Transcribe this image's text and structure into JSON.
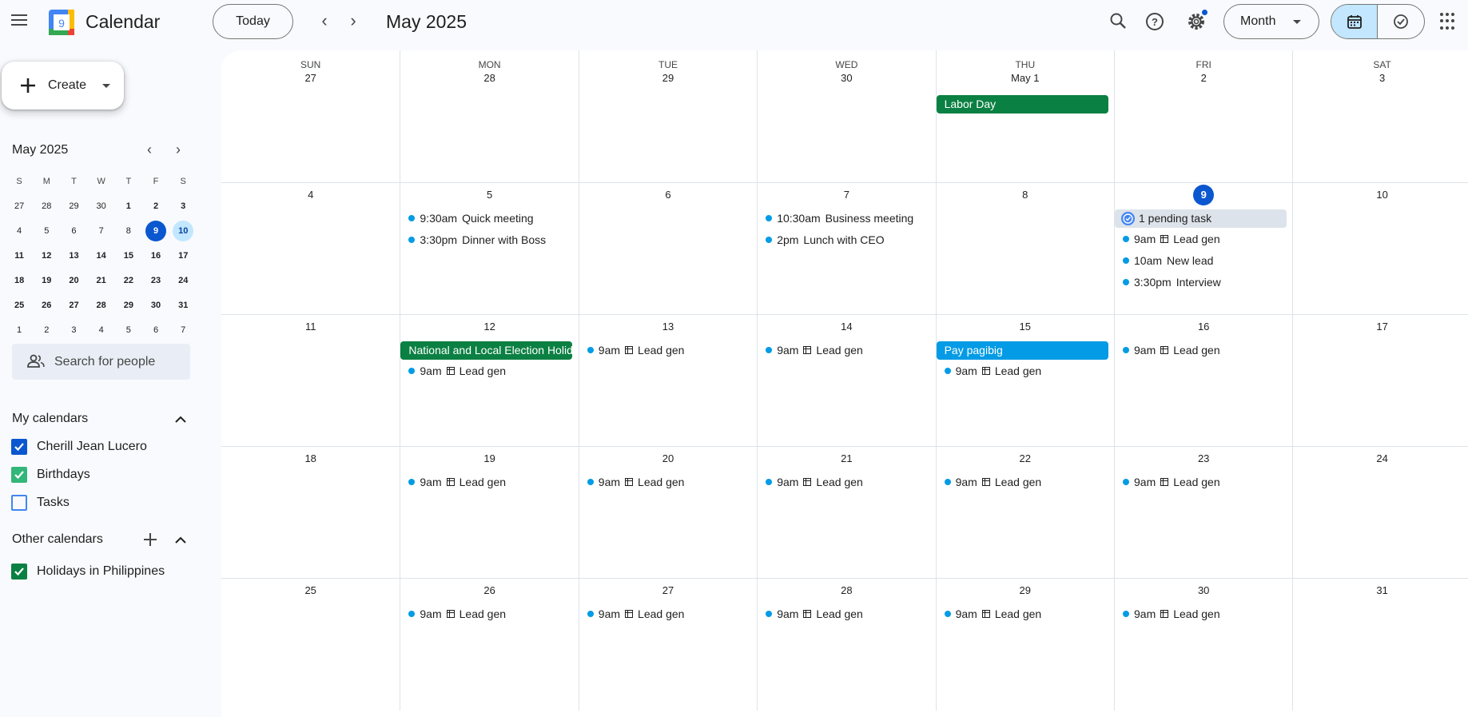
{
  "app": {
    "title": "Calendar"
  },
  "toolbar": {
    "today_label": "Today",
    "current_period": "May 2025",
    "view_label": "Month",
    "notification_dot_color": "#0b57d0"
  },
  "sidebar": {
    "create_label": "Create",
    "mini_calendar": {
      "title": "May 2025",
      "weekday_heads": [
        "S",
        "M",
        "T",
        "W",
        "T",
        "F",
        "S"
      ],
      "weeks": [
        [
          "27",
          "28",
          "29",
          "30",
          "1",
          "2",
          "3"
        ],
        [
          "4",
          "5",
          "6",
          "7",
          "8",
          "9",
          "10"
        ],
        [
          "11",
          "12",
          "13",
          "14",
          "15",
          "16",
          "17"
        ],
        [
          "18",
          "19",
          "20",
          "21",
          "22",
          "23",
          "24"
        ],
        [
          "25",
          "26",
          "27",
          "28",
          "29",
          "30",
          "31"
        ],
        [
          "1",
          "2",
          "3",
          "4",
          "5",
          "6",
          "7"
        ]
      ],
      "today": "9",
      "selected": "10"
    },
    "people_search_placeholder": "Search for people",
    "my_calendars": {
      "title": "My calendars",
      "items": [
        {
          "label": "Cherill Jean Lucero",
          "checked": true,
          "color": "#0b57d0"
        },
        {
          "label": "Birthdays",
          "checked": true,
          "color": "#33b679"
        },
        {
          "label": "Tasks",
          "checked": false,
          "color": "#4285f4"
        }
      ]
    },
    "other_calendars": {
      "title": "Other calendars",
      "items": [
        {
          "label": "Holidays in Philippines",
          "checked": true,
          "color": "#0b8043"
        }
      ]
    }
  },
  "grid": {
    "weekdays": [
      "SUN",
      "MON",
      "TUE",
      "WED",
      "THU",
      "FRI",
      "SAT"
    ],
    "weeks": [
      [
        {
          "label": "27"
        },
        {
          "label": "28"
        },
        {
          "label": "29"
        },
        {
          "label": "30"
        },
        {
          "label": "May 1",
          "chips": [
            {
              "text": "Labor Day",
              "style": "green"
            }
          ]
        },
        {
          "label": "2"
        },
        {
          "label": "3"
        }
      ],
      [
        {
          "label": "4"
        },
        {
          "label": "5",
          "events": [
            {
              "time": "9:30am",
              "title": "Quick meeting"
            },
            {
              "time": "3:30pm",
              "title": "Dinner with Boss"
            }
          ]
        },
        {
          "label": "6"
        },
        {
          "label": "7",
          "events": [
            {
              "time": "10:30am",
              "title": "Business meeting"
            },
            {
              "time": "2pm",
              "title": "Lunch with CEO"
            }
          ]
        },
        {
          "label": "8"
        },
        {
          "label": "9",
          "today": true,
          "chips": [
            {
              "text": "1 pending task",
              "style": "task"
            }
          ],
          "events": [
            {
              "time": "9am",
              "title": "Lead gen",
              "table_icon": true
            },
            {
              "time": "10am",
              "title": "New lead"
            },
            {
              "time": "3:30pm",
              "title": "Interview"
            }
          ]
        },
        {
          "label": "10"
        }
      ],
      [
        {
          "label": "11"
        },
        {
          "label": "12",
          "chips": [
            {
              "text": "National and Local Election Holiday",
              "style": "green"
            }
          ],
          "events": [
            {
              "time": "9am",
              "title": "Lead gen",
              "table_icon": true
            }
          ]
        },
        {
          "label": "13",
          "events": [
            {
              "time": "9am",
              "title": "Lead gen",
              "table_icon": true
            }
          ]
        },
        {
          "label": "14",
          "events": [
            {
              "time": "9am",
              "title": "Lead gen",
              "table_icon": true
            }
          ]
        },
        {
          "label": "15",
          "chips": [
            {
              "text": "Pay pagibig",
              "style": "blue"
            }
          ],
          "events": [
            {
              "time": "9am",
              "title": "Lead gen",
              "table_icon": true
            }
          ]
        },
        {
          "label": "16",
          "events": [
            {
              "time": "9am",
              "title": "Lead gen",
              "table_icon": true
            }
          ]
        },
        {
          "label": "17"
        }
      ],
      [
        {
          "label": "18"
        },
        {
          "label": "19",
          "events": [
            {
              "time": "9am",
              "title": "Lead gen",
              "table_icon": true
            }
          ]
        },
        {
          "label": "20",
          "events": [
            {
              "time": "9am",
              "title": "Lead gen",
              "table_icon": true
            }
          ]
        },
        {
          "label": "21",
          "events": [
            {
              "time": "9am",
              "title": "Lead gen",
              "table_icon": true
            }
          ]
        },
        {
          "label": "22",
          "events": [
            {
              "time": "9am",
              "title": "Lead gen",
              "table_icon": true
            }
          ]
        },
        {
          "label": "23",
          "events": [
            {
              "time": "9am",
              "title": "Lead gen",
              "table_icon": true
            }
          ]
        },
        {
          "label": "24"
        }
      ],
      [
        {
          "label": "25"
        },
        {
          "label": "26",
          "events": [
            {
              "time": "9am",
              "title": "Lead gen",
              "table_icon": true
            }
          ]
        },
        {
          "label": "27",
          "events": [
            {
              "time": "9am",
              "title": "Lead gen",
              "table_icon": true
            }
          ]
        },
        {
          "label": "28",
          "events": [
            {
              "time": "9am",
              "title": "Lead gen",
              "table_icon": true
            }
          ]
        },
        {
          "label": "29",
          "events": [
            {
              "time": "9am",
              "title": "Lead gen",
              "table_icon": true
            }
          ]
        },
        {
          "label": "30",
          "events": [
            {
              "time": "9am",
              "title": "Lead gen",
              "table_icon": true
            }
          ]
        },
        {
          "label": "31"
        }
      ]
    ]
  }
}
